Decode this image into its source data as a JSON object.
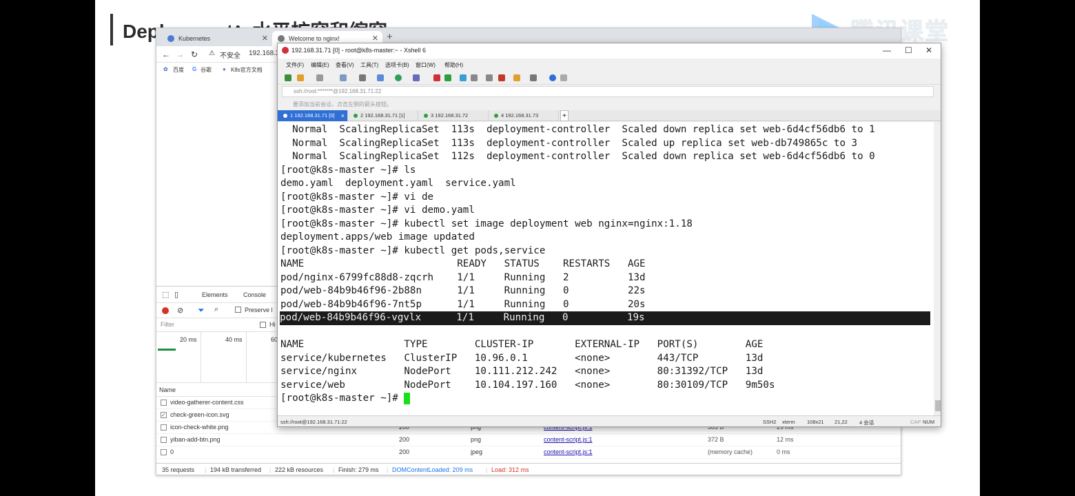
{
  "slide": {
    "title": "Deployment：水平扩容和缩容",
    "logo": "腾讯课堂"
  },
  "chrome": {
    "tabs": [
      {
        "label": "Kubernetes"
      },
      {
        "label": "Welcome to nginx!"
      }
    ],
    "new_tab": "+",
    "address": {
      "security": "不安全",
      "url": "192.168.3"
    },
    "bookmarks": [
      "百度",
      "谷歌",
      "K8s官方文档"
    ],
    "devtools": {
      "tabs": [
        "Elements",
        "Console"
      ],
      "preserve_label": "Preserve l",
      "filter_placeholder": "Filter",
      "hide_label": "Hi",
      "timeline": [
        "20 ms",
        "40 ms",
        "60"
      ],
      "name_header": "Name",
      "rows": [
        {
          "name": "video-gatherer-content.css",
          "status": "",
          "type": "",
          "initiator": "",
          "size": "",
          "time": "",
          "checked": false
        },
        {
          "name": "check-green-icon.svg",
          "status": "",
          "type": "",
          "initiator": "",
          "size": "",
          "time": "",
          "checked": true
        },
        {
          "name": "icon-check-white.png",
          "status": "200",
          "type": "png",
          "initiator": "content-script.js:1",
          "size": "383 B",
          "time": "29 ms",
          "checked": false
        },
        {
          "name": "yiban-add-btn.png",
          "status": "200",
          "type": "png",
          "initiator": "content-script.js:1",
          "size": "372 B",
          "time": "12 ms",
          "checked": false
        },
        {
          "name": "0",
          "status": "200",
          "type": "jpeg",
          "initiator": "content-script.js:1",
          "size": "(memory cache)",
          "time": "0 ms",
          "checked": false
        }
      ],
      "status": {
        "requests": "35 requests",
        "transferred": "194 kB transferred",
        "resources": "222 kB resources",
        "finish": "Finish: 279 ms",
        "domcontent": "DOMContentLoaded: 209 ms",
        "load": "Load: 312 ms"
      }
    }
  },
  "xshell": {
    "title": "192.168.31.71 [0] - root@k8s-master:~ - Xshell 6",
    "menu": [
      "文件(F)",
      "编辑(E)",
      "查看(V)",
      "工具(T)",
      "选项卡(B)",
      "窗口(W)",
      "帮助(H)"
    ],
    "address": "ssh://root:*******@192.168.31.71:22",
    "tip": "要添加当前会话，点击左侧的箭头按钮。",
    "tabs": [
      {
        "label": "1 192.168.31.71 [0]",
        "active": true
      },
      {
        "label": "2 192.168.31.71 [1]",
        "active": false
      },
      {
        "label": "3 192.168.31.72",
        "active": false
      },
      {
        "label": "4 192.168.31.73",
        "active": false
      }
    ],
    "terminal_lines": [
      "  Normal  ScalingReplicaSet  113s  deployment-controller  Scaled down replica set web-6d4cf56db6 to 1",
      "  Normal  ScalingReplicaSet  113s  deployment-controller  Scaled up replica set web-db749865c to 3",
      "  Normal  ScalingReplicaSet  112s  deployment-controller  Scaled down replica set web-6d4cf56db6 to 0",
      "[root@k8s-master ~]# ls",
      "demo.yaml  deployment.yaml  service.yaml",
      "[root@k8s-master ~]# vi de",
      "[root@k8s-master ~]# vi demo.yaml",
      "[root@k8s-master ~]# kubectl set image deployment web nginx=nginx:1.18",
      "deployment.apps/web image updated",
      "[root@k8s-master ~]# kubectl get pods,service",
      "NAME                          READY   STATUS    RESTARTS   AGE",
      "pod/nginx-6799fc88d8-zqcrh    1/1     Running   2          13d",
      "pod/web-84b9b46f96-2b88n      1/1     Running   0          22s",
      "pod/web-84b9b46f96-7nt5p      1/1     Running   0          20s",
      "pod/web-84b9b46f96-vgvlx      1/1     Running   0          19s",
      "",
      "NAME                 TYPE        CLUSTER-IP       EXTERNAL-IP   PORT(S)        AGE",
      "service/kubernetes   ClusterIP   10.96.0.1        <none>        443/TCP        13d",
      "service/nginx        NodePort    10.111.212.242   <none>        80:31392/TCP   13d",
      "service/web          NodePort    10.104.197.160   <none>        80:30109/TCP   9m50s",
      "[root@k8s-master ~]# "
    ],
    "status": {
      "conn": "ssh://root@192.168.31.71:22",
      "proto": "SSH2",
      "term": "xterm",
      "size": "108x21",
      "pos": "21,22",
      "sessions": "4 会话",
      "caps": "CAP",
      "num": "NUM"
    }
  }
}
